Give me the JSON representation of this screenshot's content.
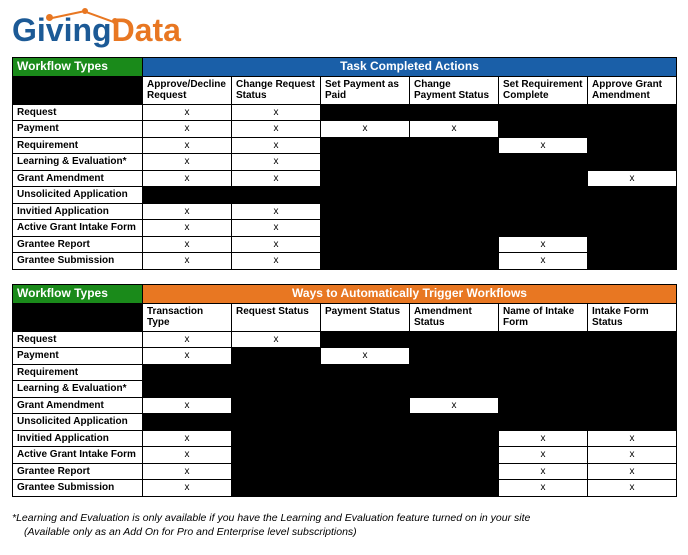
{
  "logo": {
    "part1": "Giving",
    "part2": "Data"
  },
  "table1": {
    "cornerHeader": "Workflow Types",
    "bannerHeader": "Task Completed Actions",
    "columns": [
      "Approve/Decline Request",
      "Change Request Status",
      "Set Payment as Paid",
      "Change Payment Status",
      "Set Requirement Complete",
      "Approve Grant Amendment"
    ],
    "rows": [
      {
        "label": "Request",
        "cells": [
          "x",
          "x",
          "b",
          "b",
          "b",
          "b"
        ]
      },
      {
        "label": "Payment",
        "cells": [
          "x",
          "x",
          "x",
          "x",
          "b",
          "b"
        ]
      },
      {
        "label": "Requirement",
        "cells": [
          "x",
          "x",
          "b",
          "b",
          "x",
          "b"
        ]
      },
      {
        "label": "Learning & Evaluation*",
        "cells": [
          "x",
          "x",
          "b",
          "b",
          "b",
          "b"
        ]
      },
      {
        "label": "Grant Amendment",
        "cells": [
          "x",
          "x",
          "b",
          "b",
          "b",
          "x"
        ]
      },
      {
        "label": "Unsolicited Application",
        "cells": [
          "b",
          "b",
          "b",
          "b",
          "b",
          "b"
        ]
      },
      {
        "label": "Invitied Application",
        "cells": [
          "x",
          "x",
          "b",
          "b",
          "b",
          "b"
        ]
      },
      {
        "label": "Active Grant Intake Form",
        "cells": [
          "x",
          "x",
          "b",
          "b",
          "b",
          "b"
        ]
      },
      {
        "label": "Grantee Report",
        "cells": [
          "x",
          "x",
          "b",
          "b",
          "x",
          "b"
        ]
      },
      {
        "label": "Grantee Submission",
        "cells": [
          "x",
          "x",
          "b",
          "b",
          "x",
          "b"
        ]
      }
    ]
  },
  "table2": {
    "cornerHeader": "Workflow Types",
    "bannerHeader": "Ways to Automatically Trigger Workflows",
    "columns": [
      "Transaction Type",
      "Request Status",
      "Payment Status",
      "Amendment Status",
      "Name of Intake Form",
      "Intake Form Status"
    ],
    "rows": [
      {
        "label": "Request",
        "cells": [
          "x",
          "x",
          "b",
          "b",
          "b",
          "b"
        ]
      },
      {
        "label": "Payment",
        "cells": [
          "x",
          "b",
          "x",
          "b",
          "b",
          "b"
        ]
      },
      {
        "label": "Requirement",
        "cells": [
          "b",
          "b",
          "b",
          "b",
          "b",
          "b"
        ]
      },
      {
        "label": "Learning & Evaluation*",
        "cells": [
          "b",
          "b",
          "b",
          "b",
          "b",
          "b"
        ]
      },
      {
        "label": "Grant Amendment",
        "cells": [
          "x",
          "b",
          "b",
          "x",
          "b",
          "b"
        ]
      },
      {
        "label": "Unsolicited Application",
        "cells": [
          "b",
          "b",
          "b",
          "b",
          "b",
          "b"
        ]
      },
      {
        "label": "Invitied Application",
        "cells": [
          "x",
          "b",
          "b",
          "b",
          "x",
          "x"
        ]
      },
      {
        "label": "Active Grant Intake Form",
        "cells": [
          "x",
          "b",
          "b",
          "b",
          "x",
          "x"
        ]
      },
      {
        "label": "Grantee Report",
        "cells": [
          "x",
          "b",
          "b",
          "b",
          "x",
          "x"
        ]
      },
      {
        "label": "Grantee Submission",
        "cells": [
          "x",
          "b",
          "b",
          "b",
          "x",
          "x"
        ]
      }
    ]
  },
  "footnote": {
    "line1": "*Learning and Evaluation is only available if you have the Learning and Evaluation feature turned on in your site",
    "line2": "(Available only as an Add On for Pro and Enterprise level subscriptions)"
  }
}
